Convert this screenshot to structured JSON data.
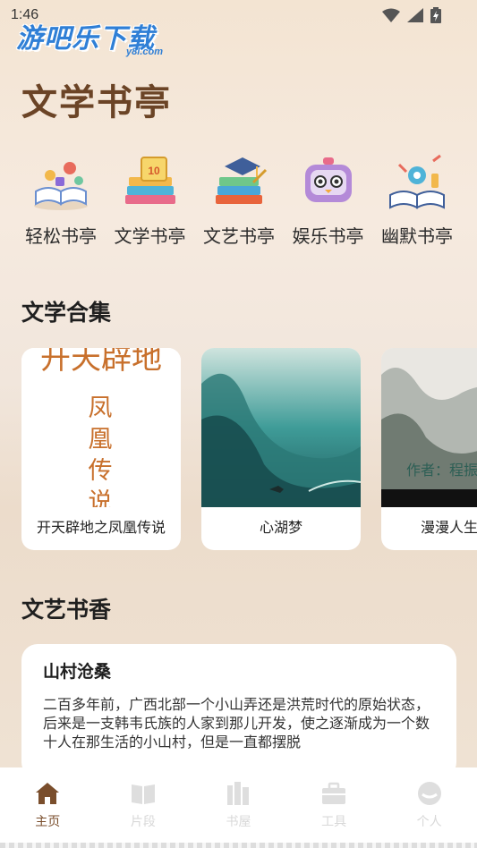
{
  "status_bar": {
    "time": "1:46"
  },
  "watermark": {
    "text": "游吧乐下载",
    "sub": "y8l.com"
  },
  "page_title": "文学书亭",
  "categories": [
    {
      "label": "轻松书亭",
      "icon": "open-book-icon"
    },
    {
      "label": "文学书亭",
      "icon": "book-stack-calendar-icon"
    },
    {
      "label": "文艺书亭",
      "icon": "graduation-books-icon"
    },
    {
      "label": "娱乐书亭",
      "icon": "robot-toy-icon"
    },
    {
      "label": "幽默书亭",
      "icon": "science-book-icon"
    }
  ],
  "collection": {
    "title": "文学合集",
    "items": [
      {
        "title": "开天辟地之凤凰传说",
        "cover_top": "开天辟地",
        "cover_vertical": [
          "凤",
          "凰",
          "传",
          "说"
        ]
      },
      {
        "title": "心湖梦"
      },
      {
        "title": "漫漫人生",
        "cover_text": "作者：程振"
      }
    ]
  },
  "arts": {
    "title": "文艺书香",
    "article": {
      "title": "山村沧桑",
      "body": "二百多年前，广西北部一个小山弄还是洪荒时代的原始状态，后来是一支韩韦氏族的人家到那儿开发，使之逐渐成为一个数十人在那生活的小山村，但是一直都摆脱"
    }
  },
  "tabbar": [
    {
      "label": "主页",
      "icon": "home-icon",
      "active": true
    },
    {
      "label": "片段",
      "icon": "open-book-tab-icon",
      "active": false
    },
    {
      "label": "书屋",
      "icon": "bookshelf-icon",
      "active": false
    },
    {
      "label": "工具",
      "icon": "toolbox-icon",
      "active": false
    },
    {
      "label": "个人",
      "icon": "person-icon",
      "active": false
    }
  ],
  "colors": {
    "accent": "#7a4e2c",
    "title_brown": "#6b4426",
    "inactive": "#d8d8d8"
  }
}
